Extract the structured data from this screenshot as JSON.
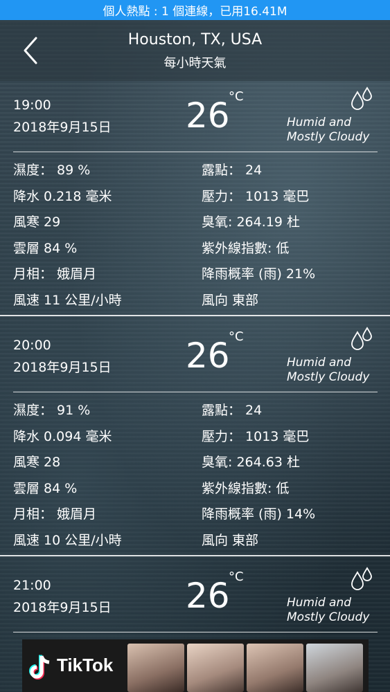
{
  "status_bar": {
    "text": "個人熱點 : 1 個連線，已用16.41M",
    "color": "#2196F3"
  },
  "header": {
    "city": "Houston, TX, USA",
    "subtitle": "每小時天氣"
  },
  "icons": {
    "back": "chevron-left-icon",
    "drop": "raindrops-icon",
    "ad_logo": "tiktok-logo-icon"
  },
  "hours": [
    {
      "time": "19:00",
      "date": "2018年9月15日",
      "temp": "26",
      "unit": "°C",
      "condition_1": "Humid and",
      "condition_2": "Mostly Cloudy",
      "humidity": "濕度： 89 %",
      "dew": "露點： 24",
      "precip": "降水 0.218 毫米",
      "pressure": "壓力： 1013 毫巴",
      "windchill": "風寒 29",
      "ozone": "臭氧: 264.19 杜",
      "cloud": "雲層 84 %",
      "uv": "紫外線指數: 低",
      "moon": "月相： 娥眉月",
      "rainprob": "降雨概率 (雨) 21%",
      "windspeed": "風速 11 公里/小時",
      "winddir": "風向 東部"
    },
    {
      "time": "20:00",
      "date": "2018年9月15日",
      "temp": "26",
      "unit": "°C",
      "condition_1": "Humid and",
      "condition_2": "Mostly Cloudy",
      "humidity": "濕度： 91 %",
      "dew": "露點： 24",
      "precip": "降水 0.094 毫米",
      "pressure": "壓力： 1013 毫巴",
      "windchill": "風寒 28",
      "ozone": "臭氧: 264.63 杜",
      "cloud": "雲層 84 %",
      "uv": "紫外線指數: 低",
      "moon": "月相： 娥眉月",
      "rainprob": "降雨概率 (雨) 14%",
      "windspeed": "風速 10 公里/小時",
      "winddir": "風向 東部"
    },
    {
      "time": "21:00",
      "date": "2018年9月15日",
      "temp": "26",
      "unit": "°C",
      "condition_1": "Humid and",
      "condition_2": "Mostly Cloudy"
    }
  ],
  "ad": {
    "brand": "TikTok"
  }
}
